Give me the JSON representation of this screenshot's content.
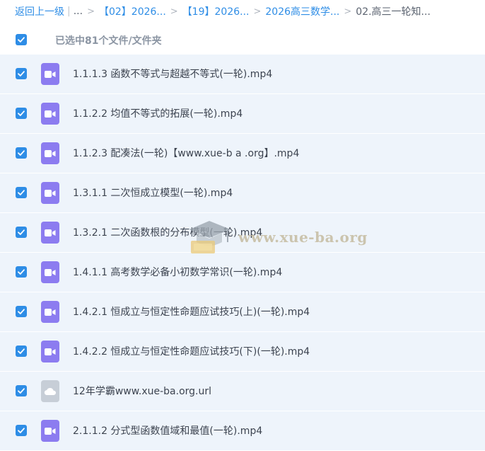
{
  "breadcrumb": {
    "back_label": "返回上一级",
    "pipe": "|",
    "ellipsis": "...",
    "sep": ">",
    "items": [
      "【02】2026...",
      "【19】2026...",
      "2026高三数学..."
    ],
    "current": "02.高三一轮知..."
  },
  "selection": {
    "summary": "已选中81个文件/文件夹"
  },
  "files": [
    {
      "name": "1.1.1.3 函数不等式与超越不等式(一轮).mp4",
      "type": "video"
    },
    {
      "name": "1.1.2.2 均值不等式的拓展(一轮).mp4",
      "type": "video"
    },
    {
      "name": "1.1.2.3 配凑法(一轮)【www.xue-b a .org】.mp4",
      "type": "video"
    },
    {
      "name": "1.3.1.1 二次恒成立模型(一轮).mp4",
      "type": "video"
    },
    {
      "name": "1.3.2.1 二次函数根的分布模型(一轮).mp4",
      "type": "video"
    },
    {
      "name": "1.4.1.1 高考数学必备小初数学常识(一轮).mp4",
      "type": "video"
    },
    {
      "name": "1.4.2.1 恒成立与恒定性命题应试技巧(上)(一轮).mp4",
      "type": "video"
    },
    {
      "name": "1.4.2.2 恒成立与恒定性命题应试技巧(下)(一轮).mp4",
      "type": "video"
    },
    {
      "name": "12年学霸www.xue-ba.org.url",
      "type": "link"
    },
    {
      "name": "2.1.1.2 分式型函数值域和最值(一轮).mp4",
      "type": "video"
    }
  ],
  "watermark": {
    "text": "www.xue-ba.org"
  },
  "colors": {
    "accent": "#2e8de6",
    "video_icon": "#8c7cf0",
    "link_icon": "#c7ced7",
    "row_bg": "#eef4fb"
  }
}
